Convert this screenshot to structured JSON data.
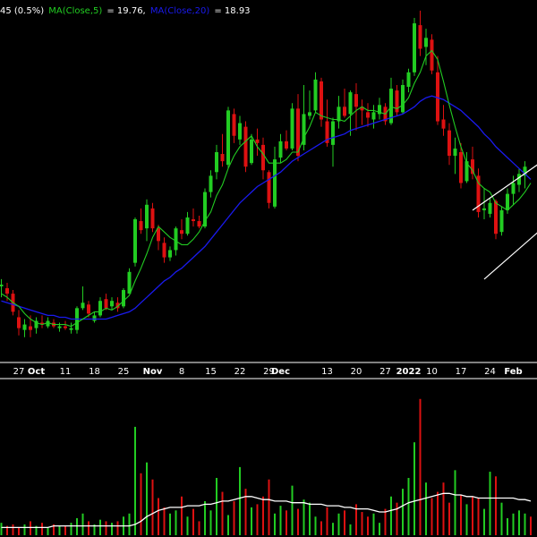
{
  "header": {
    "change_text": "45 (0.5%)",
    "ma5_label": "MA(Close,5)",
    "ma5_value": "= 19.76,",
    "ma20_label": "MA(Close,20)",
    "ma20_value": "= 18.93"
  },
  "colors": {
    "background": "#000000",
    "up": "#22cc22",
    "down": "#dd1111",
    "ma5": "#22cc22",
    "ma20": "#1a1aee",
    "volume_ma": "#ffffff",
    "trendline": "#ffffff",
    "text": "#ffffff"
  },
  "chart_data": {
    "type": "candlestick",
    "price_range": [
      9.5,
      28.0
    ],
    "volume_range": [
      0,
      100
    ],
    "x_ticks": [
      {
        "label": "27",
        "index": 3,
        "bold": false
      },
      {
        "label": "Oct",
        "index": 6,
        "bold": true
      },
      {
        "label": "11",
        "index": 11,
        "bold": false
      },
      {
        "label": "18",
        "index": 16,
        "bold": false
      },
      {
        "label": "25",
        "index": 21,
        "bold": false
      },
      {
        "label": "Nov",
        "index": 26,
        "bold": true
      },
      {
        "label": "8",
        "index": 31,
        "bold": false
      },
      {
        "label": "15",
        "index": 36,
        "bold": false
      },
      {
        "label": "22",
        "index": 41,
        "bold": false
      },
      {
        "label": "29",
        "index": 46,
        "bold": false
      },
      {
        "label": "Dec",
        "index": 48,
        "bold": true
      },
      {
        "label": "13",
        "index": 56,
        "bold": false
      },
      {
        "label": "20",
        "index": 61,
        "bold": false
      },
      {
        "label": "27",
        "index": 66,
        "bold": false
      },
      {
        "label": "2022",
        "index": 70,
        "bold": true
      },
      {
        "label": "10",
        "index": 74,
        "bold": false
      },
      {
        "label": "17",
        "index": 79,
        "bold": false
      },
      {
        "label": "24",
        "index": 84,
        "bold": false
      },
      {
        "label": "Feb",
        "index": 88,
        "bold": true
      }
    ],
    "candles": [
      [
        13.2,
        13.6,
        12.6,
        13.3
      ],
      [
        13.1,
        13.4,
        12.4,
        12.8
      ],
      [
        12.8,
        13.0,
        11.6,
        11.8
      ],
      [
        11.5,
        11.9,
        10.5,
        10.9
      ],
      [
        10.8,
        11.4,
        10.4,
        11.1
      ],
      [
        11.0,
        11.6,
        10.4,
        10.8
      ],
      [
        10.9,
        11.5,
        10.6,
        11.3
      ],
      [
        11.2,
        11.6,
        10.9,
        11.1
      ],
      [
        11.0,
        11.5,
        10.9,
        11.3
      ],
      [
        11.2,
        11.4,
        10.9,
        11.0
      ],
      [
        10.9,
        11.2,
        10.7,
        11.0
      ],
      [
        11.0,
        11.3,
        10.8,
        10.9
      ],
      [
        10.8,
        11.2,
        10.6,
        10.9
      ],
      [
        10.8,
        12.1,
        10.6,
        12.0
      ],
      [
        12.0,
        13.2,
        11.9,
        12.3
      ],
      [
        12.2,
        12.4,
        11.5,
        11.7
      ],
      [
        11.3,
        11.8,
        11.2,
        11.6
      ],
      [
        11.6,
        12.6,
        11.5,
        12.4
      ],
      [
        12.5,
        12.8,
        11.9,
        12.0
      ],
      [
        12.1,
        12.6,
        11.9,
        12.4
      ],
      [
        12.3,
        12.6,
        11.8,
        12.0
      ],
      [
        12.1,
        13.1,
        12.0,
        13.0
      ],
      [
        12.8,
        14.2,
        12.8,
        14.0
      ],
      [
        14.5,
        17.0,
        14.3,
        16.9
      ],
      [
        16.8,
        17.5,
        16.1,
        16.3
      ],
      [
        16.4,
        18.0,
        15.7,
        17.7
      ],
      [
        17.5,
        17.8,
        16.2,
        16.4
      ],
      [
        16.4,
        16.6,
        15.2,
        15.7
      ],
      [
        15.6,
        15.9,
        14.5,
        14.8
      ],
      [
        14.8,
        15.4,
        14.6,
        15.2
      ],
      [
        15.2,
        16.5,
        14.9,
        16.4
      ],
      [
        16.3,
        16.9,
        15.8,
        16.1
      ],
      [
        16.1,
        17.3,
        16.0,
        17.0
      ],
      [
        16.9,
        17.5,
        16.5,
        16.8
      ],
      [
        16.8,
        17.1,
        16.4,
        16.5
      ],
      [
        16.5,
        18.6,
        16.4,
        18.4
      ],
      [
        18.4,
        19.6,
        18.1,
        19.3
      ],
      [
        19.5,
        21.0,
        19.1,
        20.6
      ],
      [
        20.5,
        21.6,
        19.8,
        20.1
      ],
      [
        19.9,
        23.1,
        19.7,
        22.9
      ],
      [
        22.7,
        23.0,
        21.1,
        21.5
      ],
      [
        21.3,
        22.6,
        21.0,
        22.2
      ],
      [
        22.0,
        22.3,
        19.5,
        19.8
      ],
      [
        20.0,
        21.6,
        19.9,
        21.3
      ],
      [
        21.3,
        21.9,
        20.4,
        21.1
      ],
      [
        21.0,
        21.4,
        19.1,
        19.6
      ],
      [
        19.5,
        19.6,
        17.5,
        17.8
      ],
      [
        17.6,
        20.9,
        17.5,
        20.2
      ],
      [
        20.3,
        21.6,
        20.0,
        21.2
      ],
      [
        21.2,
        21.8,
        20.7,
        20.8
      ],
      [
        20.8,
        23.3,
        20.7,
        23.0
      ],
      [
        23.0,
        23.8,
        20.1,
        20.4
      ],
      [
        21.0,
        24.3,
        20.7,
        22.7
      ],
      [
        22.6,
        24.0,
        22.4,
        22.8
      ],
      [
        22.9,
        25.0,
        22.8,
        24.6
      ],
      [
        24.5,
        24.7,
        22.0,
        22.4
      ],
      [
        22.3,
        23.5,
        20.9,
        21.1
      ],
      [
        21.0,
        22.5,
        19.8,
        22.3
      ],
      [
        22.3,
        23.7,
        21.9,
        23.1
      ],
      [
        23.1,
        24.1,
        22.5,
        22.6
      ],
      [
        22.7,
        24.0,
        21.5,
        23.9
      ],
      [
        23.8,
        24.4,
        21.8,
        23.1
      ],
      [
        23.1,
        23.5,
        22.1,
        22.9
      ],
      [
        22.8,
        23.3,
        22.0,
        22.5
      ],
      [
        22.4,
        23.2,
        21.9,
        22.8
      ],
      [
        22.7,
        23.6,
        22.4,
        23.2
      ],
      [
        23.1,
        23.3,
        22.1,
        22.3
      ],
      [
        22.2,
        24.7,
        22.1,
        24.1
      ],
      [
        24.0,
        24.3,
        22.6,
        22.8
      ],
      [
        22.8,
        24.6,
        22.7,
        24.3
      ],
      [
        24.2,
        25.2,
        23.9,
        25.0
      ],
      [
        25.0,
        28.0,
        24.8,
        27.7
      ],
      [
        27.6,
        28.4,
        25.9,
        26.3
      ],
      [
        26.4,
        27.4,
        25.4,
        26.9
      ],
      [
        26.8,
        27.1,
        24.9,
        25.1
      ],
      [
        25.0,
        25.9,
        22.1,
        22.3
      ],
      [
        22.4,
        23.2,
        21.5,
        21.9
      ],
      [
        21.8,
        22.2,
        19.9,
        20.4
      ],
      [
        20.4,
        21.4,
        19.4,
        20.8
      ],
      [
        20.6,
        21.1,
        18.6,
        18.9
      ],
      [
        19.0,
        20.6,
        18.9,
        20.1
      ],
      [
        20.2,
        20.9,
        19.1,
        19.4
      ],
      [
        19.3,
        19.7,
        17.0,
        17.3
      ],
      [
        17.4,
        18.6,
        16.9,
        17.5
      ],
      [
        17.2,
        18.1,
        17.0,
        17.8
      ],
      [
        17.9,
        18.0,
        15.8,
        16.1
      ],
      [
        16.2,
        17.6,
        16.0,
        17.4
      ],
      [
        17.4,
        18.6,
        17.2,
        18.3
      ],
      [
        18.3,
        19.3,
        17.7,
        18.9
      ],
      [
        18.8,
        19.7,
        18.4,
        19.4
      ],
      [
        19.3,
        20.1,
        18.6,
        19.8
      ]
    ],
    "volume": [
      8,
      6,
      7,
      5,
      7,
      9,
      6,
      8,
      5,
      7,
      6,
      6,
      8,
      11,
      14,
      9,
      7,
      10,
      9,
      8,
      9,
      12,
      14,
      70,
      40,
      47,
      36,
      24,
      18,
      14,
      16,
      25,
      12,
      17,
      9,
      22,
      16,
      37,
      28,
      13,
      22,
      44,
      30,
      18,
      20,
      25,
      36,
      14,
      19,
      16,
      32,
      17,
      23,
      21,
      12,
      9,
      18,
      8,
      14,
      16,
      7,
      20,
      15,
      12,
      14,
      8,
      17,
      25,
      21,
      30,
      37,
      60,
      88,
      34,
      24,
      28,
      34,
      21,
      42,
      26,
      20,
      25,
      24,
      17,
      41,
      38,
      21,
      11,
      14,
      16,
      14,
      12
    ],
    "ma5": [
      12.8,
      12.6,
      12.3,
      12.1,
      11.7,
      11.4,
      11.2,
      11.1,
      11.2,
      11.1,
      11.1,
      11.1,
      11.0,
      11.2,
      11.4,
      11.6,
      11.8,
      11.8,
      12.0,
      11.9,
      12.1,
      12.4,
      12.7,
      13.5,
      14.2,
      15.0,
      15.9,
      16.5,
      16.2,
      15.9,
      15.7,
      15.5,
      15.5,
      15.8,
      16.2,
      16.8,
      17.3,
      18.2,
      18.8,
      19.7,
      20.4,
      20.9,
      21.2,
      21.5,
      20.9,
      20.5,
      20.0,
      20.0,
      20.0,
      20.2,
      20.6,
      20.6,
      21.4,
      22.0,
      22.8,
      22.6,
      22.5,
      22.4,
      22.4,
      22.3,
      22.6,
      22.9,
      23.1,
      22.9,
      22.9,
      22.8,
      22.7,
      23.1,
      23.0,
      23.2,
      23.6,
      24.4,
      25.0,
      25.9,
      26.2,
      25.7,
      24.5,
      23.2,
      22.0,
      20.9,
      20.0,
      19.6,
      18.9,
      18.6,
      18.4,
      17.8,
      17.6,
      17.4,
      17.7,
      18.0,
      18.4,
      18.9
    ],
    "ma20": [
      12.4,
      12.3,
      12.2,
      12.1,
      12.0,
      11.9,
      11.8,
      11.7,
      11.6,
      11.6,
      11.5,
      11.5,
      11.4,
      11.4,
      11.4,
      11.4,
      11.4,
      11.4,
      11.4,
      11.5,
      11.6,
      11.7,
      11.8,
      12.0,
      12.3,
      12.6,
      12.9,
      13.2,
      13.5,
      13.7,
      14.0,
      14.2,
      14.5,
      14.8,
      15.1,
      15.4,
      15.8,
      16.2,
      16.6,
      17.0,
      17.4,
      17.8,
      18.1,
      18.4,
      18.7,
      18.9,
      19.1,
      19.3,
      19.5,
      19.8,
      20.1,
      20.3,
      20.5,
      20.7,
      20.9,
      21.1,
      21.3,
      21.4,
      21.5,
      21.6,
      21.8,
      21.9,
      22.0,
      22.1,
      22.2,
      22.3,
      22.4,
      22.5,
      22.6,
      22.7,
      22.9,
      23.1,
      23.4,
      23.6,
      23.7,
      23.6,
      23.5,
      23.3,
      23.1,
      22.9,
      22.6,
      22.3,
      22.0,
      21.6,
      21.3,
      20.9,
      20.6,
      20.3,
      20.0,
      19.7,
      19.4,
      19.1
    ],
    "volume_ma": [
      5,
      5,
      5,
      5,
      5,
      5,
      5,
      5,
      5,
      6,
      6,
      6,
      6,
      6,
      6,
      6,
      6,
      6,
      6,
      6,
      6,
      6,
      6,
      7,
      9,
      12,
      14,
      16,
      17,
      18,
      18,
      18,
      19,
      19,
      19,
      20,
      20,
      21,
      22,
      22,
      23,
      24,
      25,
      25,
      24,
      23,
      23,
      22,
      22,
      22,
      21,
      21,
      21,
      20,
      20,
      20,
      19,
      19,
      19,
      18,
      18,
      17,
      17,
      17,
      16,
      15,
      15,
      16,
      17,
      19,
      21,
      22,
      23,
      24,
      25,
      26,
      27,
      27,
      26,
      26,
      25,
      25,
      24,
      24,
      24,
      24,
      24,
      24,
      24,
      23,
      23,
      22
    ],
    "trendlines": [
      {
        "from": {
          "index": 81,
          "value": 17.4
        },
        "to": {
          "index": 93,
          "value": 20.1
        }
      },
      {
        "from": {
          "index": 83,
          "value": 13.6
        },
        "to": {
          "index": 93,
          "value": 16.4
        }
      }
    ]
  }
}
